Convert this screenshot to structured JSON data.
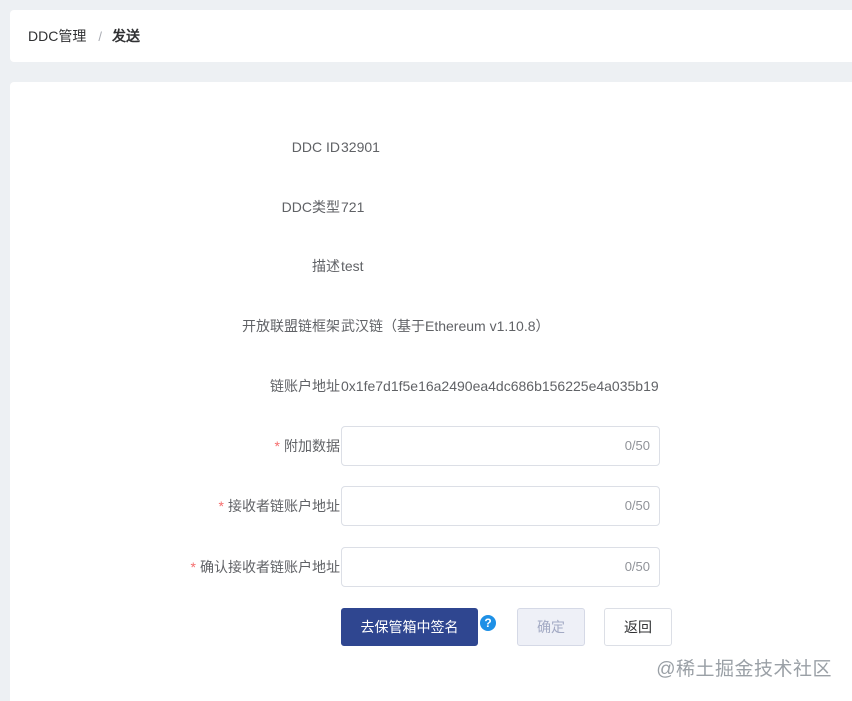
{
  "breadcrumb": {
    "parent": "DDC管理",
    "separator": "/",
    "current": "发送"
  },
  "details": [
    {
      "label": "DDC ID",
      "value": "32901"
    },
    {
      "label": "DDC类型",
      "value": "721"
    },
    {
      "label": "描述",
      "value": "test"
    },
    {
      "label": "开放联盟链框架",
      "value": "武汉链（基于Ethereum v1.10.8）"
    },
    {
      "label": "链账户地址",
      "value": "0x1fe7d1f5e16a2490ea4dc686b156225e4a035b19"
    }
  ],
  "form": {
    "required_mark": "*",
    "extra_data": {
      "label": "附加数据",
      "value": "",
      "counter": "0/50"
    },
    "receiver_address": {
      "label": "接收者链账户地址",
      "value": "",
      "counter": "0/50"
    },
    "confirm_receiver_address": {
      "label": "确认接收者链账户地址",
      "value": "",
      "counter": "0/50"
    }
  },
  "actions": {
    "sign_label": "去保管箱中签名",
    "help_icon": "?",
    "confirm_label": "确定",
    "back_label": "返回"
  },
  "watermark": "@稀土掘金技术社区",
  "colors": {
    "primary": "#2f4690",
    "required": "#f56c6c",
    "help": "#1e90e6"
  }
}
